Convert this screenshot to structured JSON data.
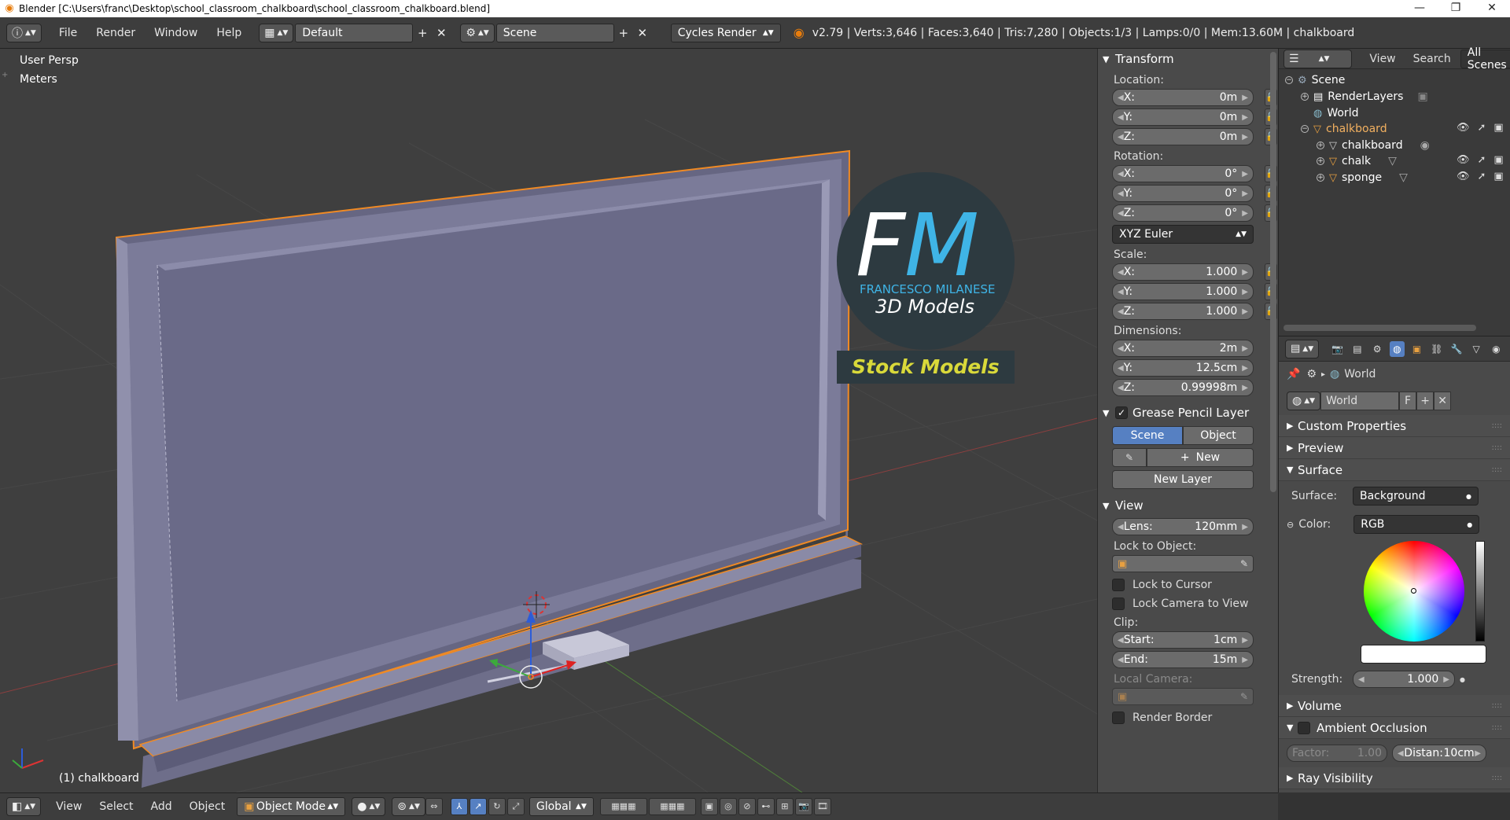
{
  "window": {
    "title": "Blender [C:\\Users\\franc\\Desktop\\school_classroom_chalkboard\\school_classroom_chalkboard.blend]",
    "minimize": "—",
    "maximize": "❐",
    "close": "✕"
  },
  "info_header": {
    "menus": [
      "File",
      "Render",
      "Window",
      "Help"
    ],
    "screen_layout": "Default",
    "scene": "Scene",
    "render_engine": "Cycles Render",
    "stats": "v2.79 | Verts:3,646 | Faces:3,640 | Tris:7,280 | Objects:1/3 | Lamps:0/0 | Mem:13.60M | chalkboard"
  },
  "viewport": {
    "view_name": "User Persp",
    "units": "Meters",
    "active_object_label": "(1) chalkboard",
    "watermark": {
      "logo_letters": "FM",
      "logo_name": "FRANCESCO MILANESE",
      "logo_sub": "3D Models",
      "banner": "Stock Models"
    }
  },
  "n_panel": {
    "transform": {
      "title": "Transform",
      "location_label": "Location:",
      "location": [
        {
          "axis": "X:",
          "value": "0m"
        },
        {
          "axis": "Y:",
          "value": "0m"
        },
        {
          "axis": "Z:",
          "value": "0m"
        }
      ],
      "rotation_label": "Rotation:",
      "rotation": [
        {
          "axis": "X:",
          "value": "0°"
        },
        {
          "axis": "Y:",
          "value": "0°"
        },
        {
          "axis": "Z:",
          "value": "0°"
        }
      ],
      "rotation_mode": "XYZ Euler",
      "scale_label": "Scale:",
      "scale": [
        {
          "axis": "X:",
          "value": "1.000"
        },
        {
          "axis": "Y:",
          "value": "1.000"
        },
        {
          "axis": "Z:",
          "value": "1.000"
        }
      ],
      "dimensions_label": "Dimensions:",
      "dimensions": [
        {
          "axis": "X:",
          "value": "2m"
        },
        {
          "axis": "Y:",
          "value": "12.5cm"
        },
        {
          "axis": "Z:",
          "value": "0.99998m"
        }
      ]
    },
    "grease_pencil": {
      "title": "Grease Pencil Layer",
      "tabs": [
        "Scene",
        "Object"
      ],
      "new_label": "New",
      "new_layer_label": "New Layer"
    },
    "view": {
      "title": "View",
      "lens_label": "Lens:",
      "lens_value": "120mm",
      "lock_to_object_label": "Lock to Object:",
      "lock_to_cursor": "Lock to Cursor",
      "lock_camera": "Lock Camera to View",
      "clip_label": "Clip:",
      "clip_start_label": "Start:",
      "clip_start": "1cm",
      "clip_end_label": "End:",
      "clip_end": "15m",
      "local_camera_label": "Local Camera:",
      "render_border": "Render Border"
    }
  },
  "outliner": {
    "menus": [
      "View",
      "Search"
    ],
    "filter": "All Scenes",
    "items": {
      "scene": "Scene",
      "renderlayers": "RenderLayers",
      "world": "World",
      "chalkboard_group": "chalkboard",
      "chalkboard": "chalkboard",
      "chalk": "chalk",
      "sponge": "sponge"
    }
  },
  "properties": {
    "context_path": "World",
    "world_name": "World",
    "fake_user": "F",
    "sections": {
      "custom_properties": "Custom Properties",
      "preview": "Preview",
      "surface": "Surface",
      "volume": "Volume",
      "ambient_occlusion": "Ambient Occlusion",
      "ray_visibility": "Ray Visibility"
    },
    "surface_label": "Surface:",
    "surface_value": "Background",
    "color_label": "Color:",
    "color_value": "RGB",
    "strength_label": "Strength:",
    "strength_value": "1.000",
    "ao_factor_label": "Factor:",
    "ao_factor_value": "1.00",
    "ao_distance_label": "Distan:",
    "ao_distance_value": "10cm"
  },
  "bottom_bar": {
    "menus": [
      "View",
      "Select",
      "Add",
      "Object"
    ],
    "mode": "Object Mode",
    "orientation": "Global"
  },
  "colors": {
    "accent_blue": "#5680c2",
    "selection_orange": "#f08a24",
    "background": "#3f3f3f"
  }
}
